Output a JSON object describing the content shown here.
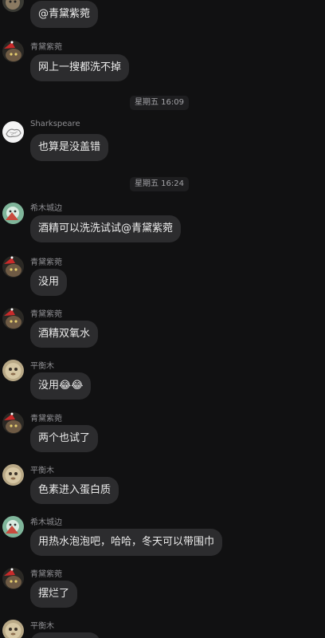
{
  "timestamps": [
    "星期五 16:09",
    "星期五 16:24"
  ],
  "messages": [
    {
      "sender": "",
      "text": "@青黛紫菀"
    },
    {
      "sender": "青黛紫菀",
      "text": "网上一搜都洗不掉"
    },
    {
      "sender": "Sharkspeare",
      "text": "也算是没盖错"
    },
    {
      "sender": "希木城边",
      "text": "酒精可以洗洗试试@青黛紫菀"
    },
    {
      "sender": "青黛紫菀",
      "text": "没用"
    },
    {
      "sender": "青黛紫菀",
      "text": "酒精双氧水"
    },
    {
      "sender": "平衡木",
      "text": "没用😂😂"
    },
    {
      "sender": "青黛紫菀",
      "text": "两个也试了"
    },
    {
      "sender": "平衡木",
      "text": "色素进入蛋白质"
    },
    {
      "sender": "希木城边",
      "text": "用热水泡泡吧，哈哈，冬天可以带围巾"
    },
    {
      "sender": "青黛紫菀",
      "text": "摆烂了"
    },
    {
      "sender": "平衡木",
      "text": ""
    }
  ],
  "colors": {
    "background": "#111112",
    "bubble": "#2c2c2e",
    "text": "#ececec",
    "sender": "#8e8e92",
    "timestamp_bg": "#1e1e20"
  },
  "avatars": {
    "qingdai": "dark-cat-with-santa-hat-avatar",
    "sharkspeare": "white-sketch-avatar",
    "ximu": "green-cartoon-avatar",
    "pinghengmu": "round-creature-avatar"
  }
}
